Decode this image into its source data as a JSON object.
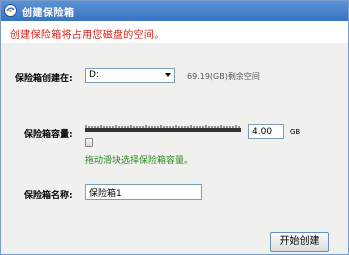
{
  "window": {
    "title": "创建保险箱",
    "subtitle": "创建保险箱将占用您磁盘的空间。"
  },
  "location": {
    "label": "保险箱创建在:",
    "selected": "D:",
    "free_space": "69.19(GB)剩余空间"
  },
  "capacity": {
    "label": "保险箱容量:",
    "value": "4.00",
    "unit": "GB",
    "slider_fraction": 0.0,
    "hint": "拖动滑块选择保险箱容量。"
  },
  "name": {
    "label": "保险箱名称:",
    "value": "保险箱1"
  },
  "actions": {
    "start_label": "开始创建"
  },
  "icons": {
    "title_icon": "safe-app-icon",
    "dropdown_icon": "chevron-down-icon"
  },
  "colors": {
    "titlebar": "#3a73c0",
    "subtitle_red": "#d4201a",
    "hint_green": "#2b8a1e",
    "content_bg": "#f0f0ef"
  }
}
